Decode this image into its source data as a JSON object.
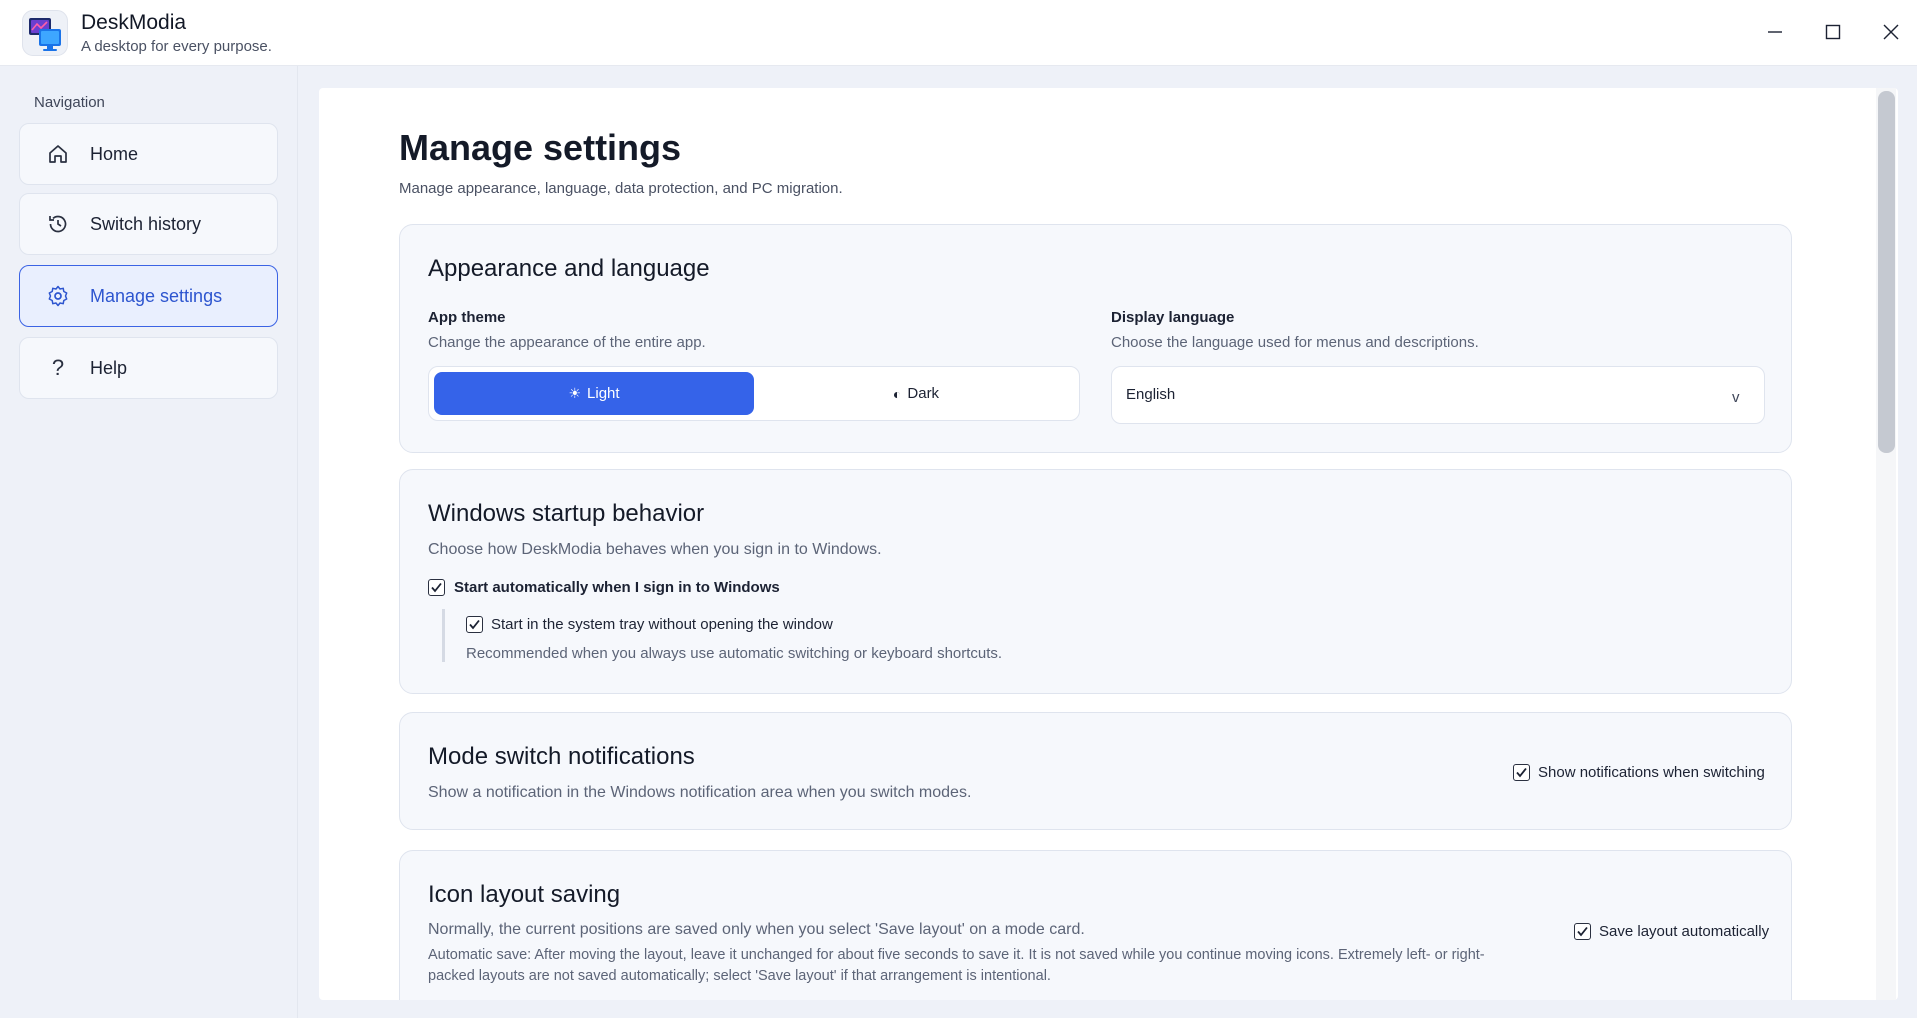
{
  "app": {
    "name": "DeskModia",
    "tagline": "A desktop for every purpose."
  },
  "sidebar": {
    "heading": "Navigation",
    "items": [
      {
        "label": "Home",
        "icon": "home-icon"
      },
      {
        "label": "Switch history",
        "icon": "history-icon"
      },
      {
        "label": "Manage settings",
        "icon": "gear-icon",
        "active": true
      },
      {
        "label": "Help",
        "icon": "question-icon"
      }
    ]
  },
  "page": {
    "title": "Manage settings",
    "subtitle": "Manage appearance, language, data protection, and PC migration."
  },
  "appearance": {
    "title": "Appearance and language",
    "theme_label": "App theme",
    "theme_desc": "Change the appearance of the entire app.",
    "theme_light": "Light",
    "theme_dark": "Dark",
    "language_label": "Display language",
    "language_desc": "Choose the language used for menus and descriptions.",
    "language_value": "English",
    "language_chevron": "v"
  },
  "startup": {
    "title": "Windows startup behavior",
    "desc": "Choose how DeskModia behaves when you sign in to Windows.",
    "auto_start_label": "Start automatically when I sign in to Windows",
    "auto_start_checked": true,
    "tray_label": "Start in the system tray without opening the window",
    "tray_checked": true,
    "tray_hint": "Recommended when you always use automatic switching or keyboard shortcuts."
  },
  "notifications": {
    "title": "Mode switch notifications",
    "desc": "Show a notification in the Windows notification area when you switch modes.",
    "toggle_label": "Show notifications when switching",
    "toggle_checked": true
  },
  "icon_layout": {
    "title": "Icon layout saving",
    "desc": "Normally, the current positions are saved only when you select 'Save layout' on a mode card.",
    "detail_line1": "Automatic save: After moving the layout, leave it unchanged for about five seconds to save it. It is not saved while you continue moving icons. Extremely left- or right-",
    "detail_line2": "packed layouts are not saved automatically; select 'Save layout' if that arrangement is intentional.",
    "toggle_label": "Save layout automatically",
    "toggle_checked": true
  },
  "colors": {
    "accent": "#3563e9",
    "sidebar_bg": "#eef1f8",
    "card_bg": "#f6f8fc"
  }
}
